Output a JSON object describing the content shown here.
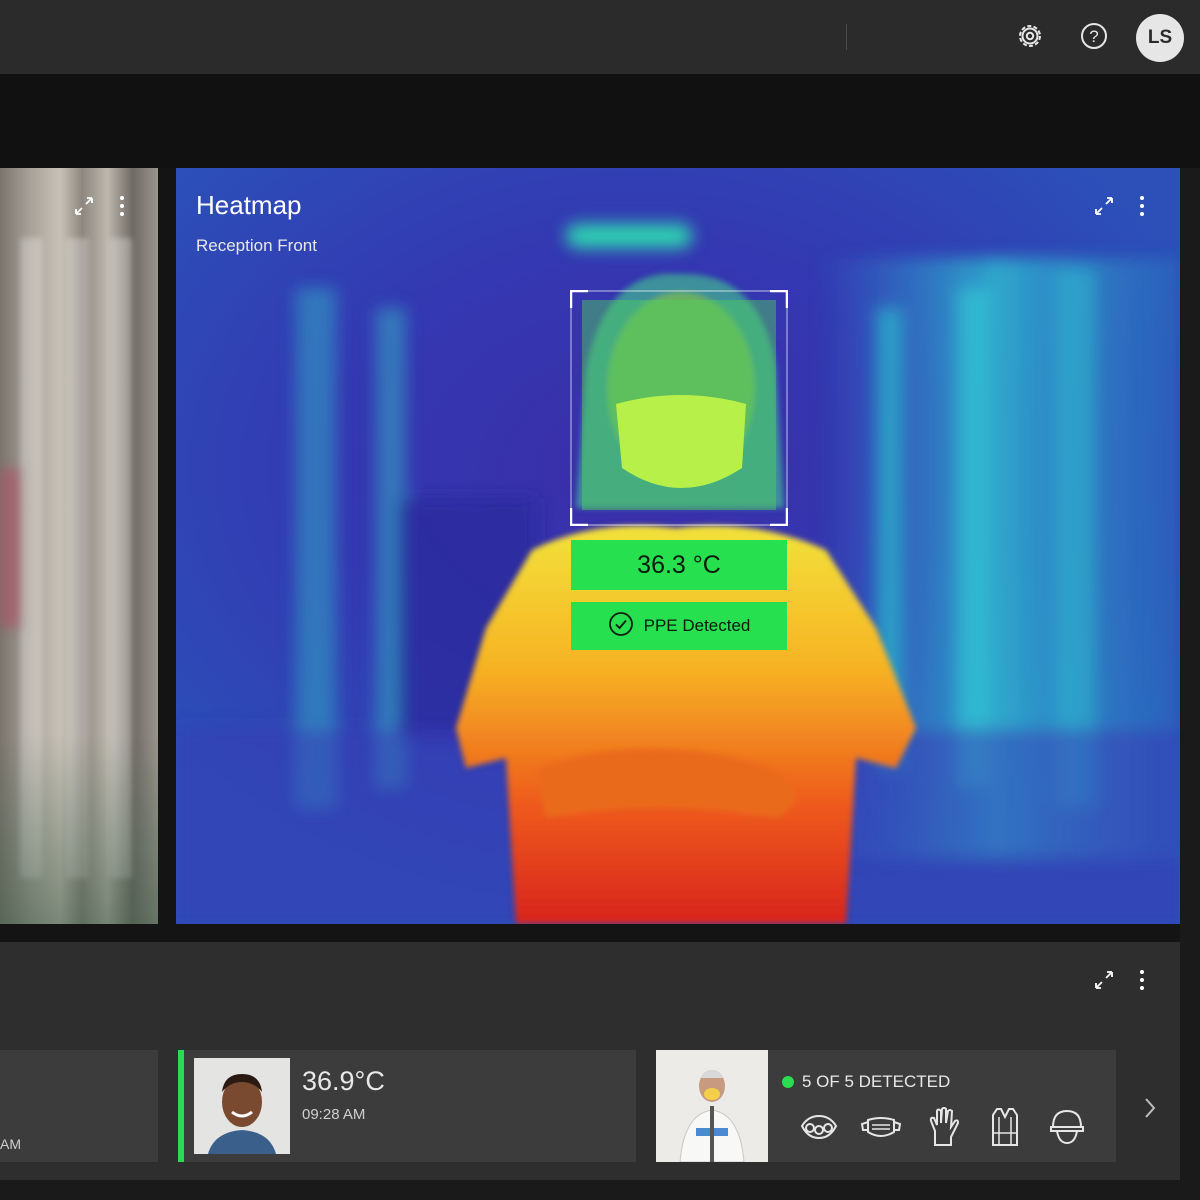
{
  "header": {
    "avatar_initials": "LS",
    "icons": [
      "gear-icon",
      "help-icon"
    ]
  },
  "heatmap": {
    "title": "Heatmap",
    "location": "Reception Front",
    "temperature": "36.3 °C",
    "ppe_status": "PPE Detected",
    "badge_color": "#27e04f"
  },
  "events": {
    "partial_card_time": "AM",
    "card2": {
      "temperature": "36.9°C",
      "time": "09:28 AM",
      "accent_color": "#2bdc50"
    },
    "card3": {
      "status": "5 OF 5 DETECTED",
      "ppe_icons": [
        "respirator-icon",
        "face-mask-icon",
        "gloves-icon",
        "gown-icon",
        "hard-hat-icon"
      ]
    }
  }
}
